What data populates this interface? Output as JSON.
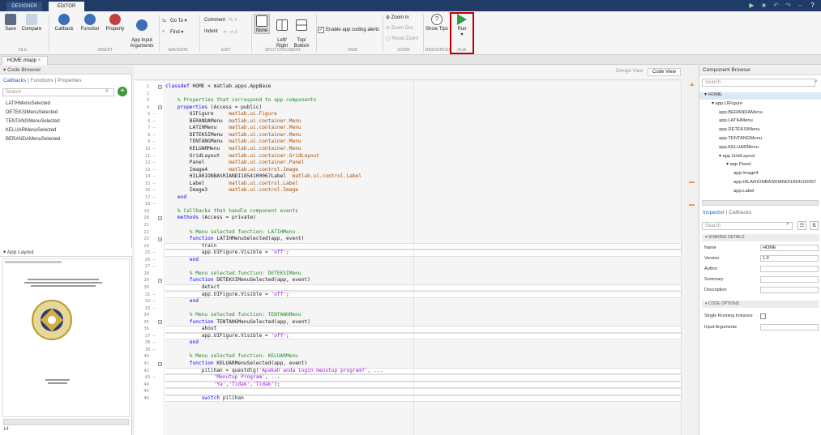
{
  "top_tabs": [
    "DESIGNER",
    "EDITOR"
  ],
  "ribbon": {
    "file": {
      "save": "Save",
      "compare": "Compare",
      "group": "FILE"
    },
    "insert": {
      "callback": "Callback",
      "function": "Function",
      "property": "Property",
      "app_input_arguments": "App Input\nArguments",
      "group": "INSERT"
    },
    "navigate": {
      "goto": "Go To ▾",
      "find": "Find ▾",
      "group": "NAVIGATE"
    },
    "edit": {
      "comment": "Comment",
      "indent": "Indent",
      "group": "EDIT"
    },
    "split": {
      "none": "None",
      "left_right": "Left/\nRight",
      "top_bottom": "Top/\nBottom",
      "group": "SPLIT DOCUMENT"
    },
    "view": {
      "coding_alerts": "Enable app coding alerts",
      "group": "VIEW"
    },
    "zoom": {
      "zoom_in": "Zoom In",
      "zoom_out": "Zoom Out",
      "reset": "Reset Zoom",
      "group": "ZOOM"
    },
    "resources": {
      "show_tips": "Show Tips",
      "group": "RESOURCES"
    },
    "run": {
      "run": "Run",
      "group": "RUN"
    }
  },
  "file_tab": "HOME.mlapp",
  "code_browser": {
    "title": "Code Browser",
    "tabs": [
      "Callbacks",
      "Functions",
      "Properties"
    ],
    "search_placeholder": "Search",
    "items": [
      "LATIHMenuSelected",
      "DETEKSIMenuSelected",
      "TENTANGMenuSelected",
      "KELUARMenuSelected",
      "BERANDAMenuSelected"
    ]
  },
  "app_layout": {
    "title": "App Layout",
    "status": "14"
  },
  "editor": {
    "view_design": "Design View",
    "view_code": "Code View",
    "lines": [
      "classdef HOME < matlab.apps.AppBase",
      "",
      "    % Properties that correspond to app components",
      "    properties (Access = public)",
      "        UIFigure     matlab.ui.Figure",
      "        BERANDAMenu  matlab.ui.container.Menu",
      "        LATIHMenu    matlab.ui.container.Menu",
      "        DETEKSIMenu  matlab.ui.container.Menu",
      "        TENTANGMenu  matlab.ui.container.Menu",
      "        KELUARMenu   matlab.ui.container.Menu",
      "        GridLayout   matlab.ui.container.GridLayout",
      "        Panel        matlab.ui.container.Panel",
      "        Image4       matlab.ui.control.Image",
      "        HILARIONBASRIANDI1854100067Label  matlab.ui.control.Label",
      "        Label        matlab.ui.control.Label",
      "        Image3       matlab.ui.control.Image",
      "    end",
      "",
      "    % Callbacks that handle component events",
      "    methods (Access = private)",
      "",
      "        % Menu selected function: LATIHMenu",
      "        function LATIHMenuSelected(app, event)",
      "            train",
      "            app.UIFigure.Visible = 'off';",
      "        end",
      "",
      "        % Menu selected function: DETEKSIMenu",
      "        function DETEKSIMenuSelected(app, event)",
      "            detect",
      "            app.UIFigure.Visible = 'off';",
      "        end",
      "",
      "        % Menu selected function: TENTANGMenu",
      "        function TENTANGMenuSelected(app, event)",
      "            about",
      "            app.UIFigure.Visible = 'off';",
      "        end",
      "",
      "        % Menu selected function: KELUARMenu",
      "        function KELUARMenuSelected(app, event)",
      "            pilihan = questdlg('Apakah anda ingin menutup program?', ...",
      "                'Menutup Program', ...",
      "                'Ya','Tidak','Tidak');",
      "",
      "            switch pilihan"
    ]
  },
  "component_browser": {
    "title": "Component Browser",
    "search_placeholder": "Search",
    "tree": [
      {
        "label": "HOME",
        "depth": 0,
        "expander": "▾"
      },
      {
        "label": "app.UIFigure",
        "depth": 1,
        "expander": "▾"
      },
      {
        "label": "app.BERANDAMenu",
        "depth": 2,
        "expander": ""
      },
      {
        "label": "app.LATIHMenu",
        "depth": 2,
        "expander": ""
      },
      {
        "label": "app.DETEKSIMenu",
        "depth": 2,
        "expander": ""
      },
      {
        "label": "app.TENTANGMenu",
        "depth": 2,
        "expander": ""
      },
      {
        "label": "app.KELUARMenu",
        "depth": 2,
        "expander": ""
      },
      {
        "label": "app.GridLayout",
        "depth": 2,
        "expander": "▾"
      },
      {
        "label": "app.Panel",
        "depth": 3,
        "expander": "▾"
      },
      {
        "label": "app.Image4",
        "depth": 4,
        "expander": ""
      },
      {
        "label": "app.HILARIONBASRIANDI1854100067",
        "depth": 4,
        "expander": ""
      },
      {
        "label": "app.Label",
        "depth": 4,
        "expander": ""
      }
    ]
  },
  "inspector": {
    "tabs": [
      "Inspector",
      "Callbacks"
    ],
    "search_placeholder": "Search",
    "sharing_details": "SHARING DETAILS",
    "fields": [
      {
        "label": "Name",
        "value": "HOME"
      },
      {
        "label": "Version",
        "value": "1.0"
      },
      {
        "label": "Author",
        "value": ""
      },
      {
        "label": "Summary",
        "value": ""
      },
      {
        "label": "Description",
        "value": ""
      }
    ],
    "code_options": "CODE OPTIONS",
    "single_running_instance": "Single Running Instance",
    "input_arguments": "Input Arguments"
  },
  "colors": {
    "accent": "#1f3b66",
    "run_highlight": "#c00000",
    "keyword": "#0e00ff",
    "comment": "#228b22",
    "string": "#a709f5"
  }
}
